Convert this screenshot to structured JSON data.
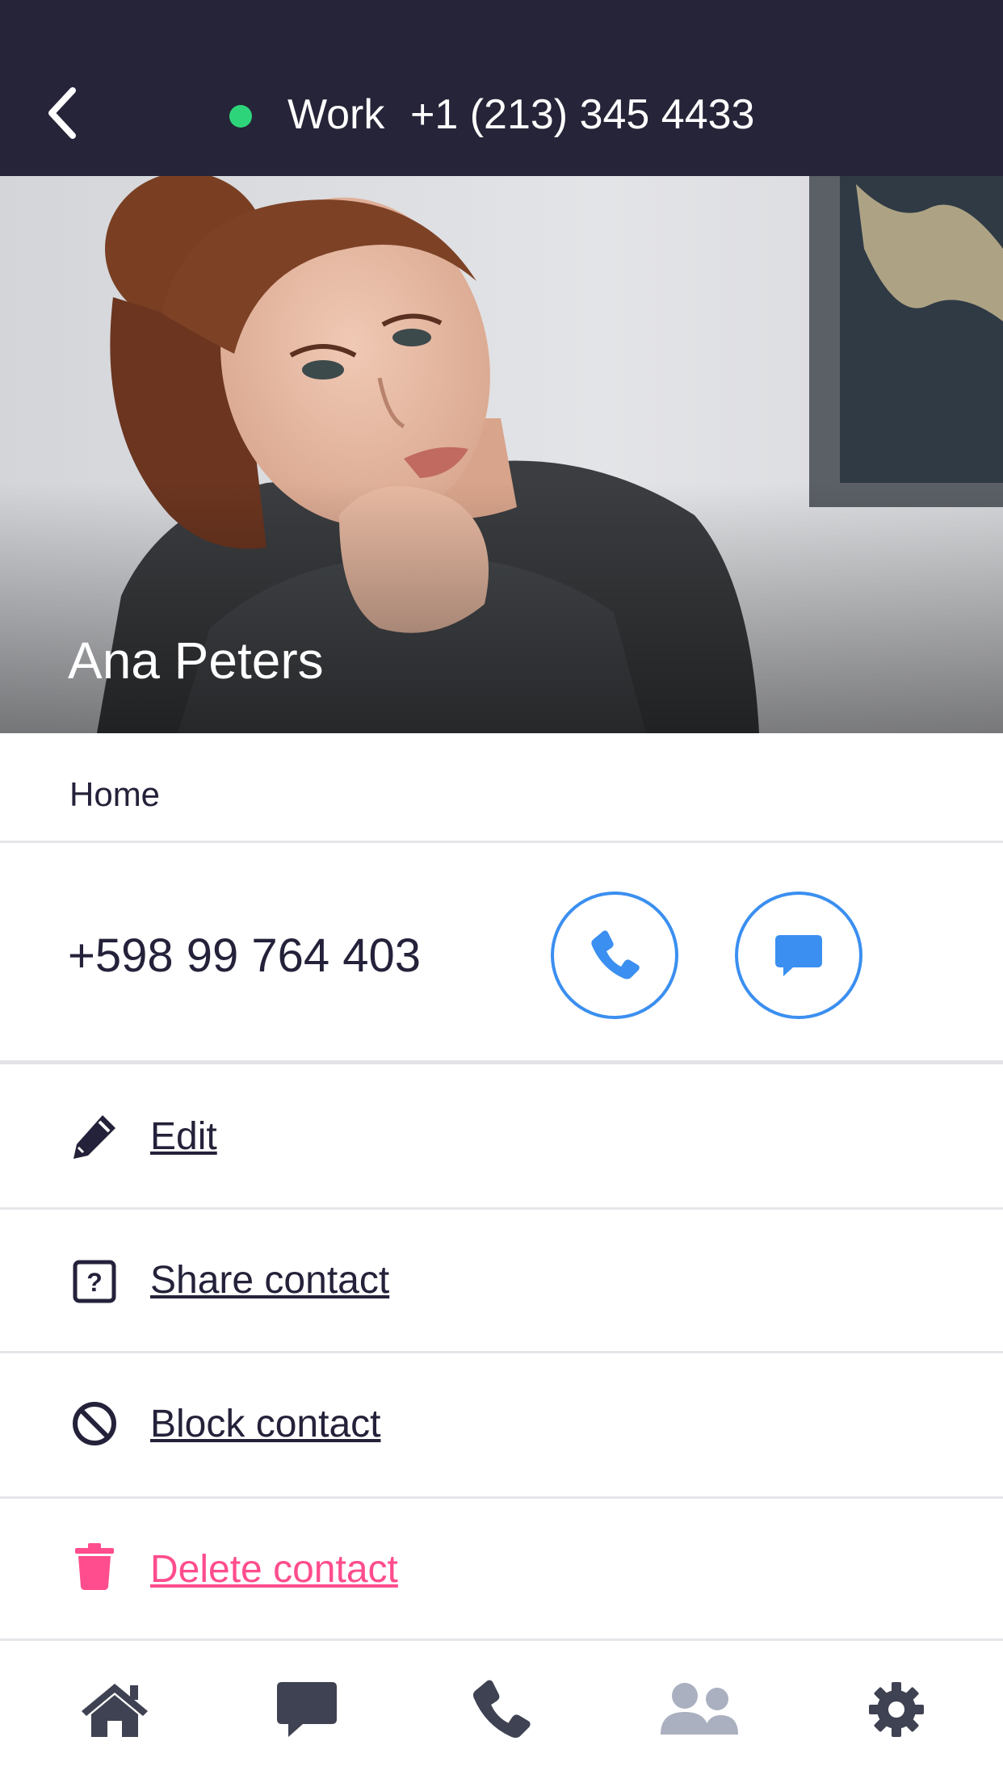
{
  "header": {
    "status_color": "#2ed47a",
    "label": "Work",
    "phone": "+1 (213) 345 4433"
  },
  "contact": {
    "name": "Ana Peters",
    "phone_type": "Home",
    "phone_number": "+598 99 764 403"
  },
  "actions": {
    "edit": "Edit",
    "share": "Share contact",
    "block": "Block contact",
    "delete": "Delete contact"
  },
  "nav": {
    "items": [
      "home-icon",
      "chat-icon",
      "phone-icon",
      "contacts-icon",
      "settings-icon"
    ],
    "active": "contacts-icon"
  },
  "colors": {
    "header_bg": "#262438",
    "accent": "#3b8ff0",
    "danger": "#ff4d8d",
    "nav_icon": "#3f4252",
    "nav_active": "#aab0bf"
  }
}
